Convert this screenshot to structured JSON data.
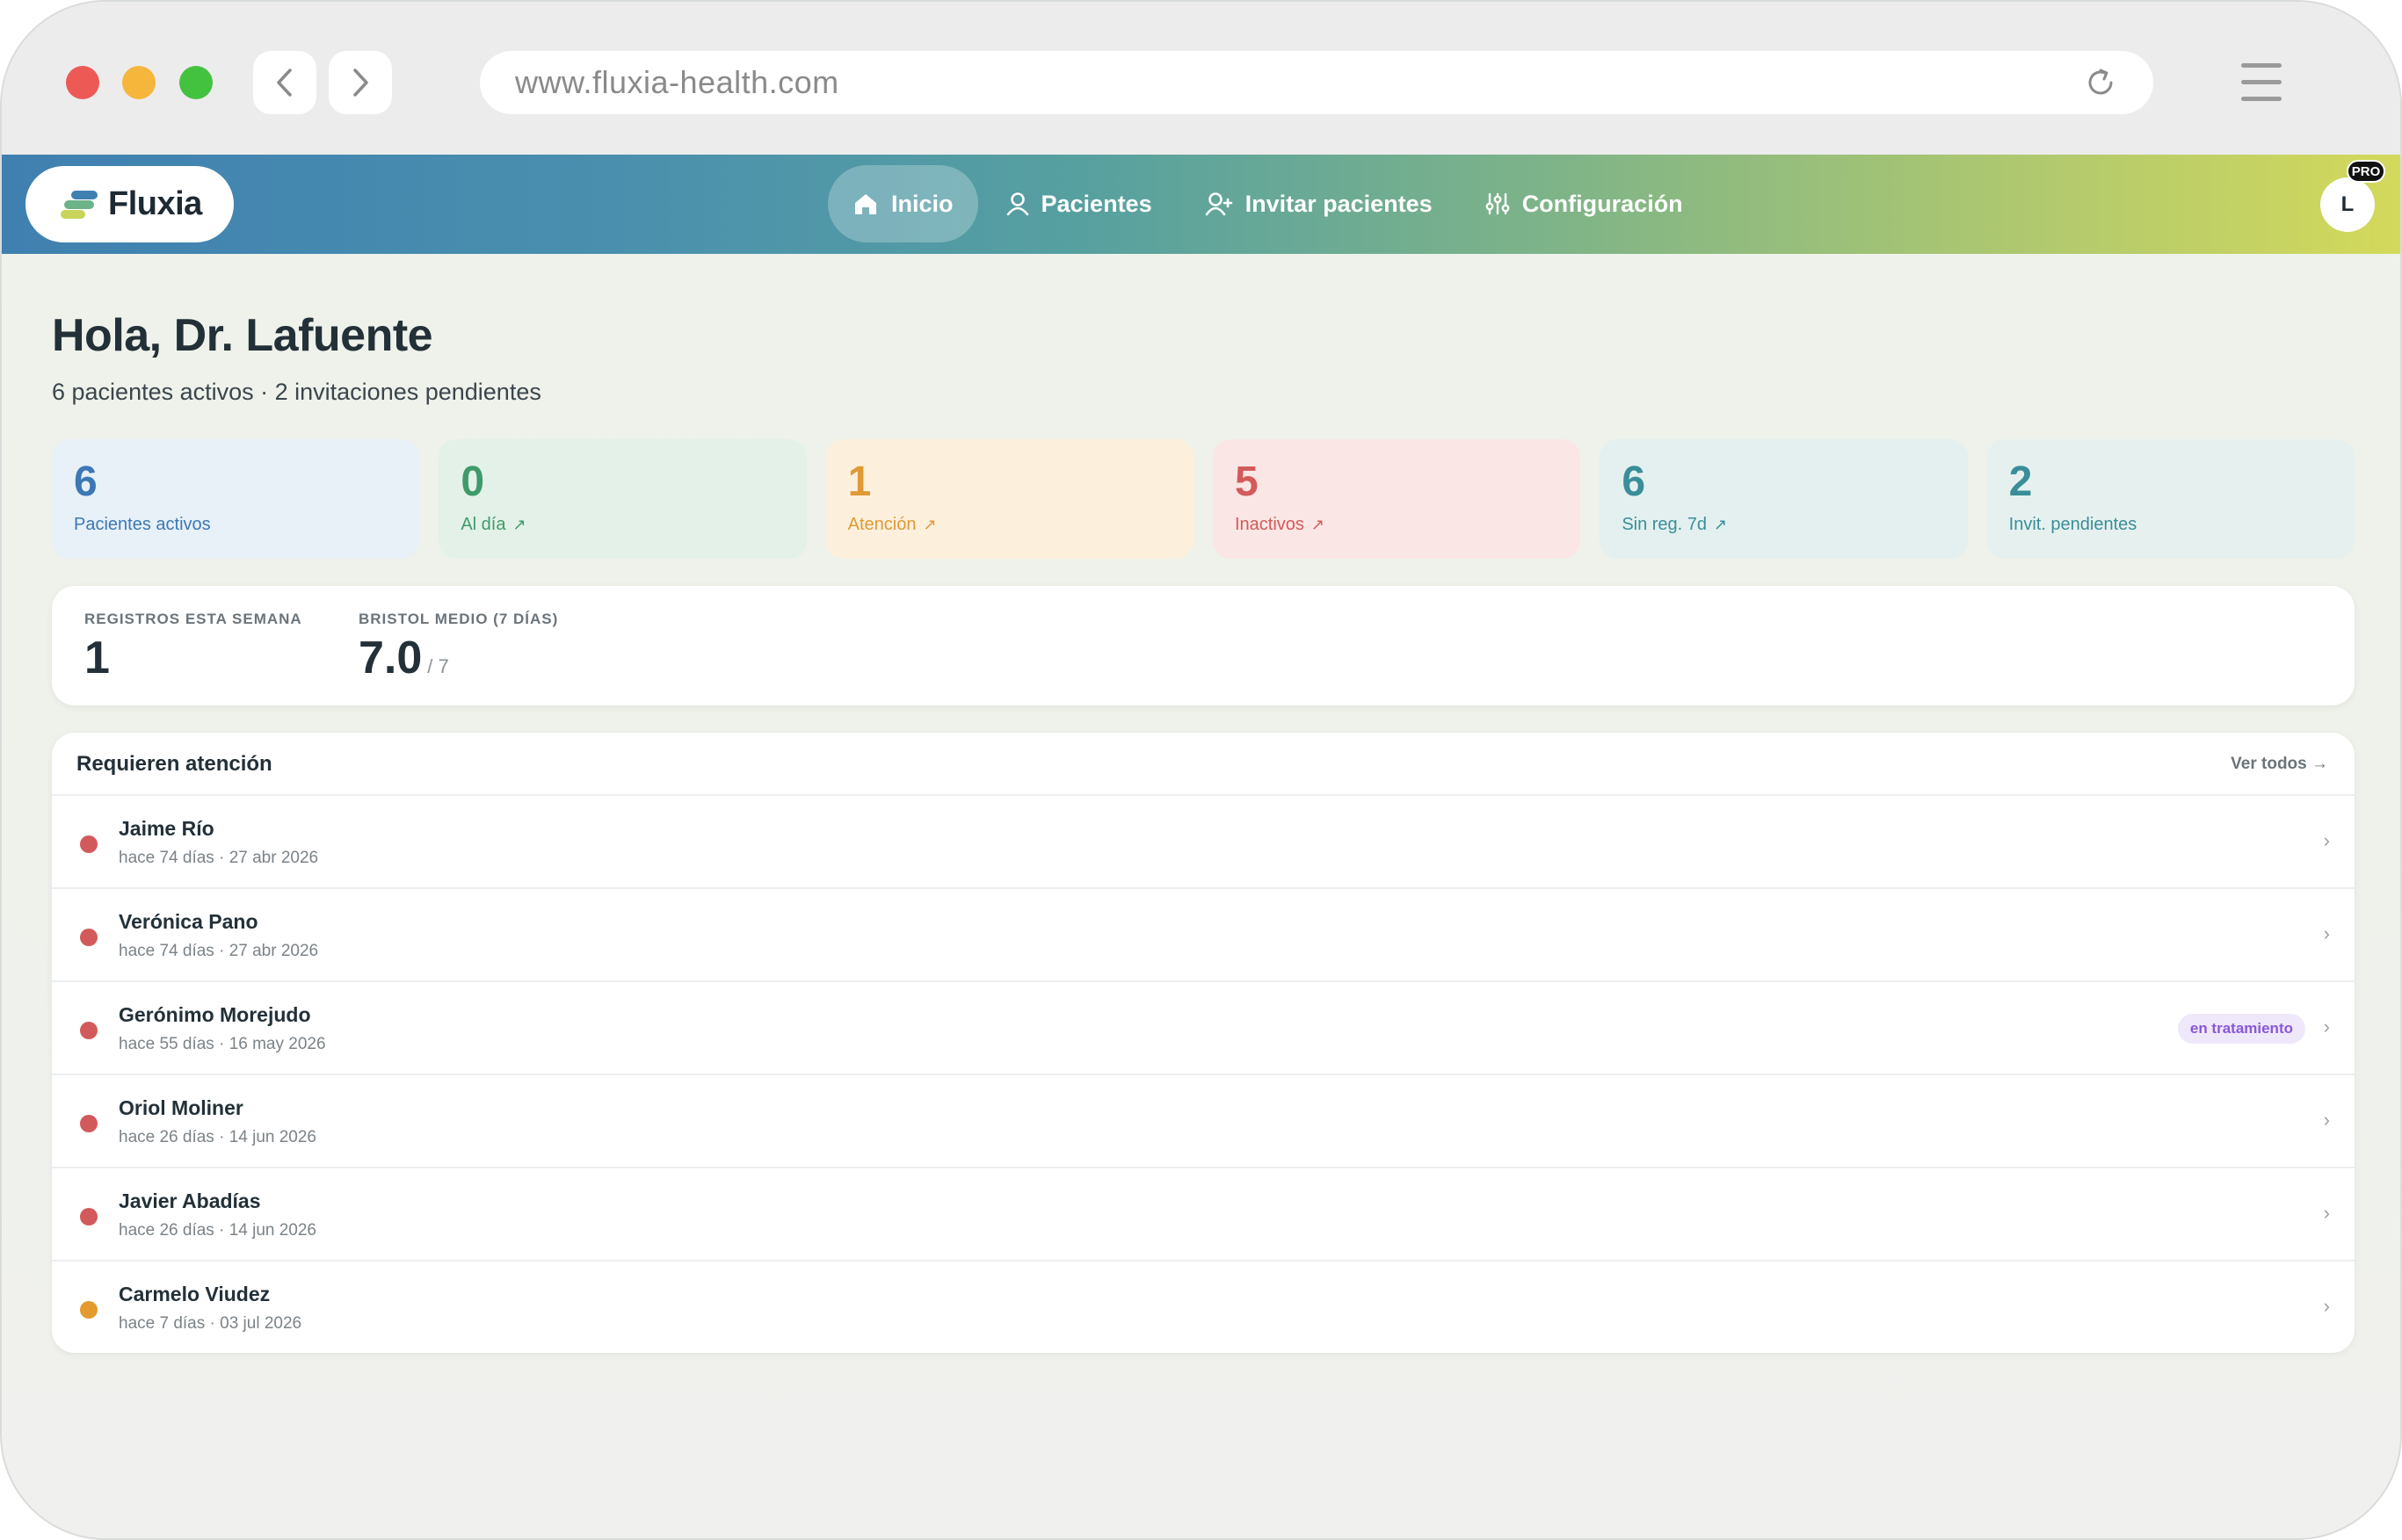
{
  "browser": {
    "url": "www.fluxia-health.com",
    "icons": [
      "chevron-left-icon",
      "chevron-right-icon",
      "reload-icon",
      "hamburger-menu-icon"
    ]
  },
  "app": {
    "brand": "Fluxia",
    "nav": [
      {
        "label": "Inicio",
        "icon": "home-icon",
        "active": true
      },
      {
        "label": "Pacientes",
        "icon": "user-icon",
        "active": false
      },
      {
        "label": "Invitar pacientes",
        "icon": "user-plus-icon",
        "active": false
      },
      {
        "label": "Configuración",
        "icon": "sliders-icon",
        "active": false
      }
    ],
    "avatar_initial": "L",
    "badge": "PRO"
  },
  "header": {
    "greeting": "Hola, Dr. Lafuente",
    "subline": "6 pacientes activos · 2 invitaciones pendientes"
  },
  "stats": [
    {
      "value": "6",
      "label": "Pacientes activos",
      "arrow": "",
      "color": "#3c78b4",
      "bg": "#e8f0f8"
    },
    {
      "value": "0",
      "label": "Al día",
      "arrow": "↗",
      "color": "#3f9a6a",
      "bg": "#e3f1e8"
    },
    {
      "value": "1",
      "label": "Atención",
      "arrow": "↗",
      "color": "#e09a35",
      "bg": "#fcf0dd"
    },
    {
      "value": "5",
      "label": "Inactivos",
      "arrow": "↗",
      "color": "#d35a5a",
      "bg": "#fbe6e6"
    },
    {
      "value": "6",
      "label": "Sin reg. 7d",
      "arrow": "↗",
      "color": "#3a8e99",
      "bg": "#e4f0ef"
    },
    {
      "value": "2",
      "label": "Invit. pendientes",
      "arrow": "",
      "color": "#3a8e99",
      "bg": "#e6f1ef"
    }
  ],
  "summary": {
    "week_label": "REGISTROS ESTA SEMANA",
    "week_value": "1",
    "bristol_label": "BRISTOL MEDIO (7 DÍAS)",
    "bristol_value": "7.0",
    "bristol_suffix": "/ 7"
  },
  "attention": {
    "title": "Requieren atención",
    "see_all": "Ver todos →",
    "patients": [
      {
        "name": "Jaime Río",
        "meta": "hace 74 días · 27 abr 2026",
        "status_color": "#d35a5a",
        "tag": ""
      },
      {
        "name": "Verónica Pano",
        "meta": "hace 74 días · 27 abr 2026",
        "status_color": "#d35a5a",
        "tag": ""
      },
      {
        "name": "Gerónimo Morejudo",
        "meta": "hace 55 días · 16 may 2026",
        "status_color": "#d35a5a",
        "tag": "en tratamiento"
      },
      {
        "name": "Oriol Moliner",
        "meta": "hace 26 días · 14 jun 2026",
        "status_color": "#d35a5a",
        "tag": ""
      },
      {
        "name": "Javier Abadías",
        "meta": "hace 26 días · 14 jun 2026",
        "status_color": "#d35a5a",
        "tag": ""
      },
      {
        "name": "Carmelo Viudez",
        "meta": "hace 7 días · 03 jul 2026",
        "status_color": "#e39a2e",
        "tag": ""
      }
    ],
    "chevron": "›"
  }
}
